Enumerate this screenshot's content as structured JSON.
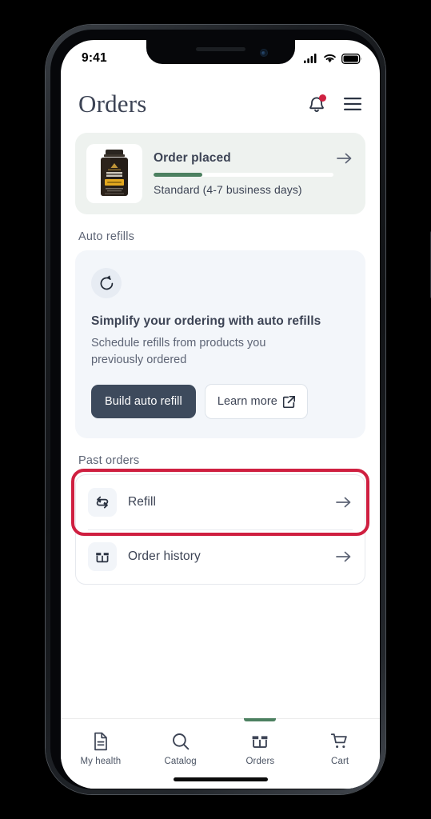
{
  "status_bar": {
    "time": "9:41",
    "cellular_icon": "cellular-signal-icon",
    "wifi_icon": "wifi-icon",
    "battery_icon": "battery-full-icon"
  },
  "header": {
    "title": "Orders",
    "notifications_icon": "bell-icon",
    "notifications_badge": true,
    "menu_icon": "hamburger-menu-icon"
  },
  "order_card": {
    "product_image_alt": "supplement-bottle",
    "title": "Order placed",
    "progress_percent": 27,
    "shipping": "Standard (4-7 business days)",
    "chevron_icon": "arrow-right-icon",
    "background_color": "#eef2ef",
    "progress_color": "#4c8060"
  },
  "auto_refills": {
    "section_label": "Auto refills",
    "icon": "refresh-circular-icon",
    "title": "Simplify your ordering with auto refills",
    "description": "Schedule refills from products you previously ordered",
    "primary_button": "Build auto refill",
    "secondary_button": "Learn more",
    "secondary_button_icon": "external-link-icon",
    "primary_color": "#3d4a5c"
  },
  "past_orders": {
    "section_label": "Past orders",
    "rows": [
      {
        "label": "Refill",
        "icon": "refill-cycle-icon",
        "arrow": "arrow-right-icon",
        "highlighted": true
      },
      {
        "label": "Order history",
        "icon": "open-box-icon",
        "arrow": "arrow-right-icon",
        "highlighted": false
      }
    ]
  },
  "highlight": {
    "color": "#cf1f40"
  },
  "tab_bar": {
    "active_color": "#4c8060",
    "tabs": [
      {
        "label": "My health",
        "icon": "document-icon",
        "active": false
      },
      {
        "label": "Catalog",
        "icon": "search-icon",
        "active": false
      },
      {
        "label": "Orders",
        "icon": "box-icon",
        "active": true
      },
      {
        "label": "Cart",
        "icon": "shopping-cart-icon",
        "active": false
      }
    ]
  }
}
